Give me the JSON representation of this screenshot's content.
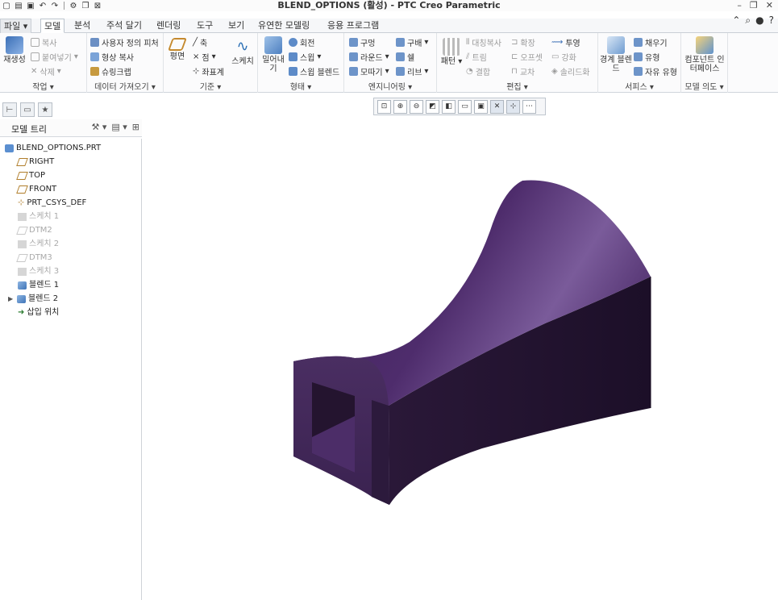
{
  "window": {
    "title": "BLEND_OPTIONS (활성) - PTC Creo Parametric",
    "controls": [
      "minimize-icon",
      "restore-icon",
      "close-icon"
    ]
  },
  "quick_access": [
    "new-icon",
    "open-icon",
    "save-icon",
    "undo-icon",
    "redo-icon",
    "regenerate-icon",
    "windows-icon",
    "close-window-icon"
  ],
  "tabs": [
    {
      "label": "파일",
      "type": "file"
    },
    {
      "label": "모델",
      "active": true
    },
    {
      "label": "분석"
    },
    {
      "label": "주석 달기"
    },
    {
      "label": "렌더링"
    },
    {
      "label": "도구"
    },
    {
      "label": "보기"
    },
    {
      "label": "유연한 모델링"
    },
    {
      "label": "응용 프로그램"
    }
  ],
  "ribbon": {
    "groups": [
      {
        "label": "작업",
        "big": "재생성",
        "items": [
          "복사",
          "붙여넣기",
          "삭제"
        ]
      },
      {
        "label": "데이터 가져오기",
        "items": [
          "사용자 정의 피처",
          "형상 복사",
          "슈링크랩"
        ]
      },
      {
        "label": "기준",
        "big": "평면",
        "items": [
          "축",
          "점",
          "좌표계"
        ],
        "big2": "스케치"
      },
      {
        "label": "형태",
        "big": "밀어내기",
        "items": [
          "회전",
          "스윕",
          "스윕 블렌드"
        ]
      },
      {
        "label": "엔지니어링",
        "items": [
          "구멍",
          "라운드",
          "모따기",
          "구배",
          "쉘",
          "리브"
        ]
      },
      {
        "label": "편집",
        "big": "패턴",
        "items": [
          "대칭복사",
          "트림",
          "결합",
          "확장",
          "오프셋",
          "교차",
          "투영",
          "강화",
          "솔리드화"
        ]
      },
      {
        "label": "서피스",
        "big": "경계 블렌드",
        "items": [
          "채우기",
          "유형",
          "자유 유형"
        ]
      },
      {
        "label": "모델 의도",
        "big": "컴포넌트 인터페이스"
      }
    ]
  },
  "navigator": {
    "panel_title": "모델 트리",
    "tree": [
      {
        "label": "BLEND_OPTIONS.PRT",
        "icon": "part-icon",
        "dim": false,
        "level": 0
      },
      {
        "label": "RIGHT",
        "icon": "datum-plane-icon",
        "dim": false,
        "level": 1
      },
      {
        "label": "TOP",
        "icon": "datum-plane-icon",
        "dim": false,
        "level": 1
      },
      {
        "label": "FRONT",
        "icon": "datum-plane-icon",
        "dim": false,
        "level": 1
      },
      {
        "label": "PRT_CSYS_DEF",
        "icon": "csys-icon",
        "dim": false,
        "level": 1
      },
      {
        "label": "스케치 1",
        "icon": "sketch-icon",
        "dim": true,
        "level": 1
      },
      {
        "label": "DTM2",
        "icon": "datum-plane-icon",
        "dim": true,
        "level": 1
      },
      {
        "label": "스케치 2",
        "icon": "sketch-icon",
        "dim": true,
        "level": 1
      },
      {
        "label": "DTM3",
        "icon": "datum-plane-icon",
        "dim": true,
        "level": 1
      },
      {
        "label": "스케치 3",
        "icon": "sketch-icon",
        "dim": true,
        "level": 1
      },
      {
        "label": "블렌드 1",
        "icon": "blend-icon",
        "dim": false,
        "level": 1
      },
      {
        "label": "블렌드 2",
        "icon": "blend-icon",
        "dim": false,
        "level": 1,
        "expandable": true
      },
      {
        "label": "삽입 위치",
        "icon": "insert-arrow-icon",
        "dim": false,
        "level": 1
      }
    ]
  },
  "view_toolbar": [
    "refit-icon",
    "zoom-in-icon",
    "zoom-out-icon",
    "repaint-icon",
    "display-style-icon",
    "saved-orientations-icon",
    "view-manager-icon",
    "datum-display-icon",
    "spin-center-icon",
    "annotation-display-icon"
  ],
  "model": {
    "color": "#4a2a66"
  }
}
